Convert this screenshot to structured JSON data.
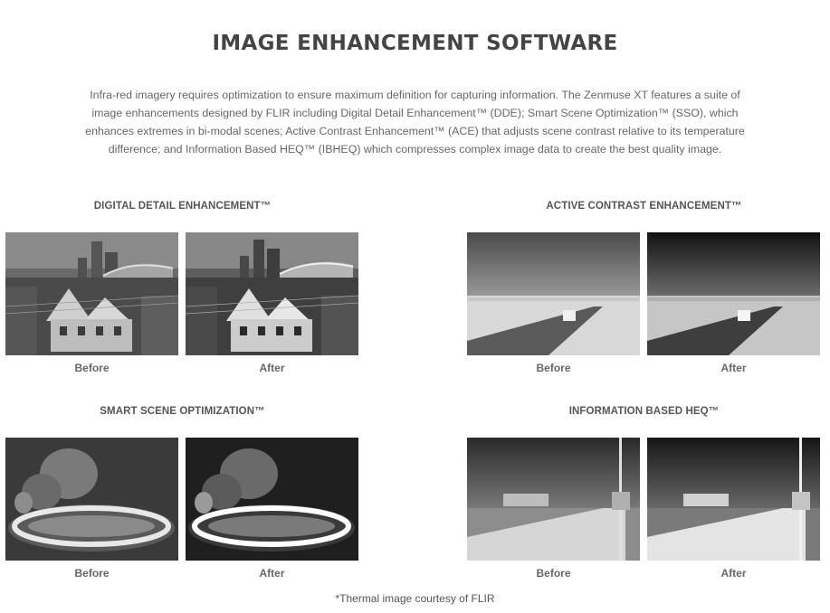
{
  "header": {
    "title": "IMAGE ENHANCEMENT SOFTWARE",
    "intro": "Infra-red imagery requires optimization to ensure maximum definition for capturing information. The Zenmuse XT features a suite of image enhancements designed by FLIR including Digital Detail Enhancement™ (DDE); Smart Scene Optimization™ (SSO), which enhances extremes in bi-modal scenes; Active Contrast Enhancement™ (ACE) that adjusts scene contrast relative to its temperature difference; and Information Based HEQ™ (IBHEQ) which compresses complex image data to create the best quality image."
  },
  "sections": {
    "dde": {
      "title": "DIGITAL DETAIL ENHANCEMENT™",
      "before": "Before",
      "after": "After"
    },
    "ace": {
      "title": "ACTIVE CONTRAST ENHANCEMENT™",
      "before": "Before",
      "after": "After"
    },
    "sso": {
      "title": "SMART SCENE OPTIMIZATION™",
      "before": "Before",
      "after": "After"
    },
    "ibheq": {
      "title": "INFORMATION BASED HEQ™",
      "before": "Before",
      "after": "After"
    }
  },
  "footnote": "*Thermal image courtesy of FLIR"
}
